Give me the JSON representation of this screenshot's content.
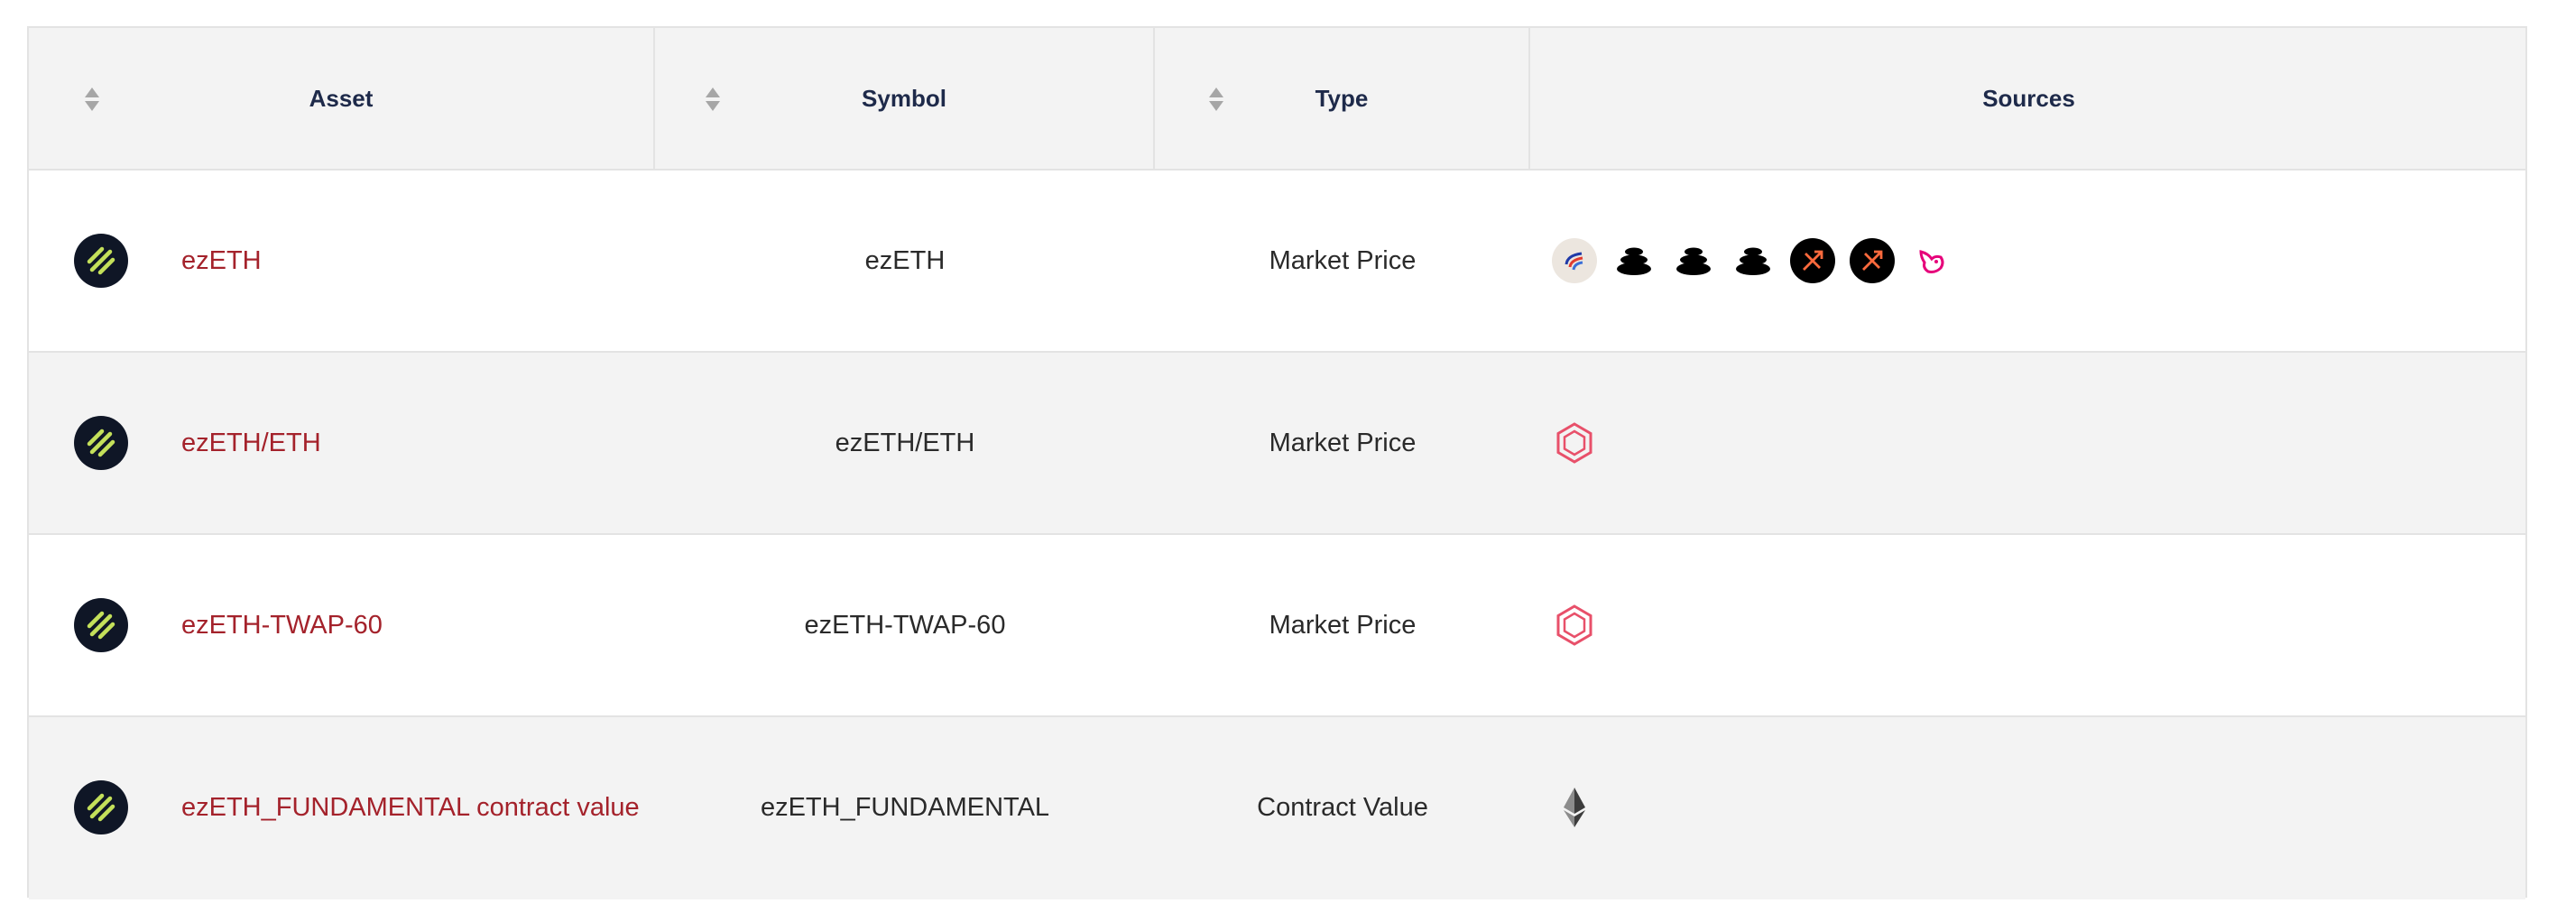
{
  "table": {
    "headers": {
      "asset": "Asset",
      "symbol": "Symbol",
      "type": "Type",
      "sources": "Sources"
    },
    "rows": [
      {
        "asset": "ezETH",
        "symbol": "ezETH",
        "type": "Market Price",
        "asset_icon": "renzo-logo-icon",
        "sources": [
          "curve-logo-icon",
          "balancer-logo-icon",
          "balancer-logo-icon",
          "balancer-logo-icon",
          "maverick-logo-icon",
          "maverick-logo-icon",
          "uniswap-logo-icon"
        ]
      },
      {
        "asset": "ezETH/ETH",
        "symbol": "ezETH/ETH",
        "type": "Market Price",
        "asset_icon": "renzo-logo-icon",
        "sources": [
          "hexagon-source-icon"
        ]
      },
      {
        "asset": "ezETH-TWAP-60",
        "symbol": "ezETH-TWAP-60",
        "type": "Market Price",
        "asset_icon": "renzo-logo-icon",
        "sources": [
          "hexagon-source-icon"
        ]
      },
      {
        "asset": "ezETH_FUNDAMENTAL contract value",
        "symbol": "ezETH_FUNDAMENTAL",
        "type": "Contract Value",
        "asset_icon": "renzo-logo-icon",
        "sources": [
          "ethereum-logo-icon"
        ]
      }
    ]
  },
  "colors": {
    "link": "#a4222b",
    "header_text": "#1e2a4a",
    "row_alt": "#f3f3f3",
    "border": "#e3e3e3",
    "renzo_green": "#c4e05a",
    "hexagon_pink": "#e8506a",
    "uniswap_pink": "#e6007a"
  }
}
